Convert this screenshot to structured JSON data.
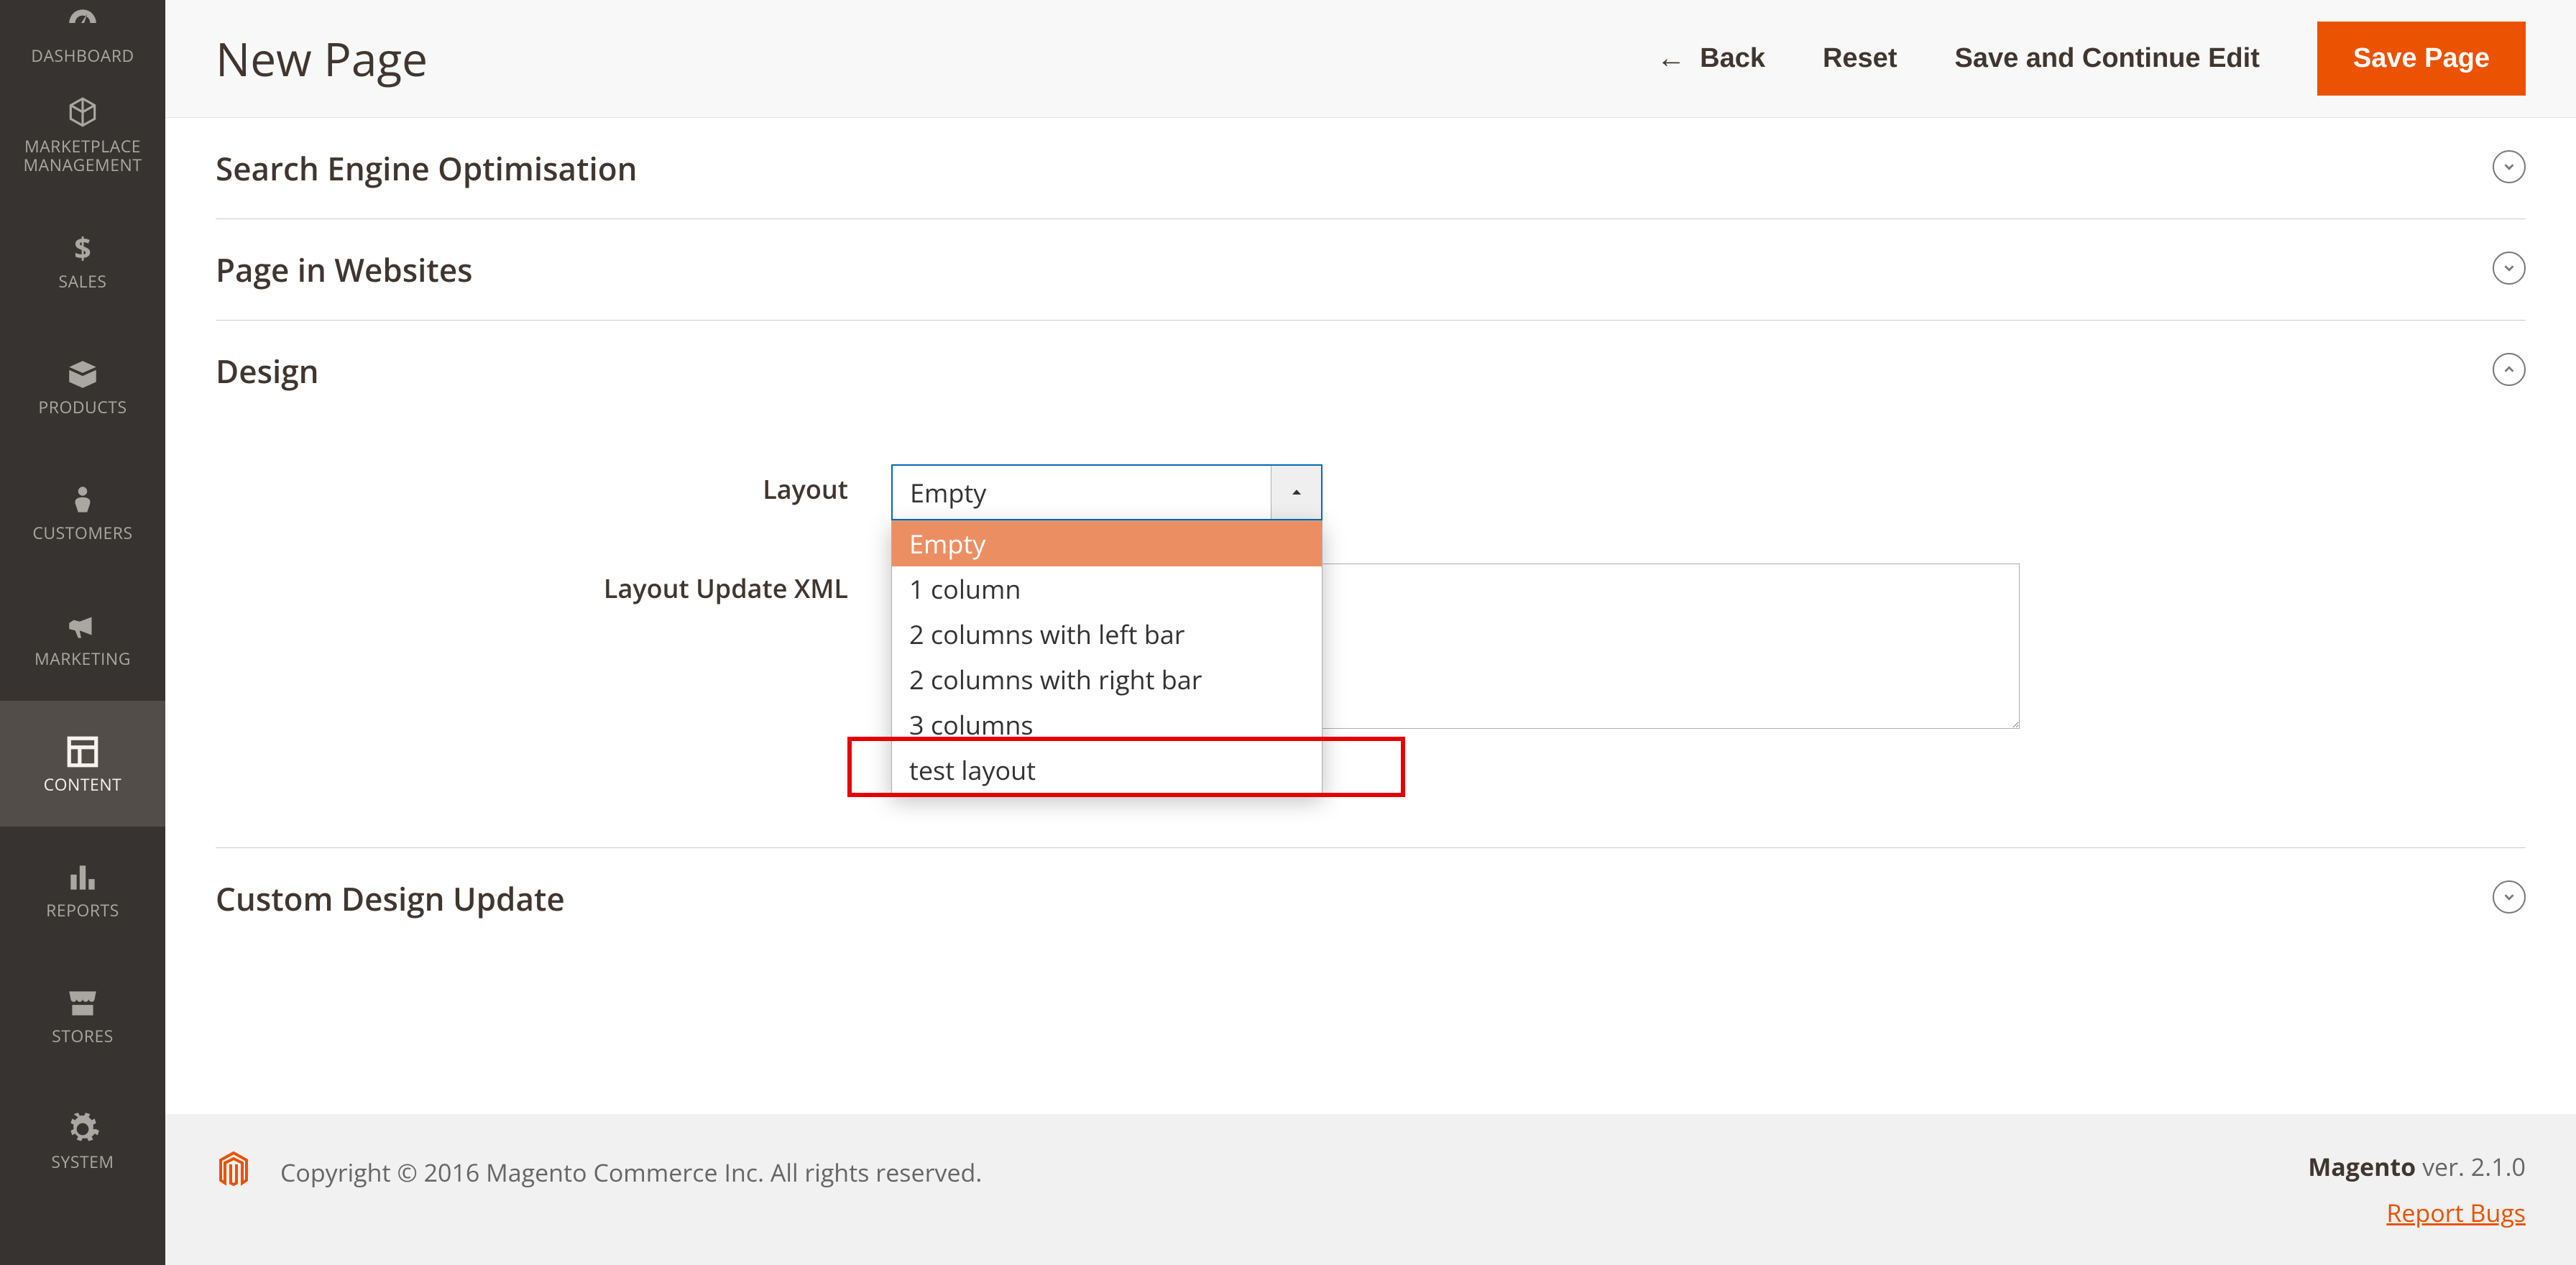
{
  "sidebar": {
    "items": [
      {
        "label": "DASHBOARD",
        "icon": "dashboard"
      },
      {
        "label": "MARKETPLACE MANAGEMENT",
        "icon": "marketplace"
      },
      {
        "label": "SALES",
        "icon": "sales"
      },
      {
        "label": "PRODUCTS",
        "icon": "products"
      },
      {
        "label": "CUSTOMERS",
        "icon": "customers"
      },
      {
        "label": "MARKETING",
        "icon": "marketing"
      },
      {
        "label": "CONTENT",
        "icon": "content"
      },
      {
        "label": "REPORTS",
        "icon": "reports"
      },
      {
        "label": "STORES",
        "icon": "stores"
      },
      {
        "label": "SYSTEM",
        "icon": "system"
      }
    ]
  },
  "header": {
    "title": "New Page",
    "back_label": "Back",
    "reset_label": "Reset",
    "savecont_label": "Save and Continue Edit",
    "save_label": "Save Page"
  },
  "sections": {
    "seo": {
      "title": "Search Engine Optimisation",
      "expanded": false
    },
    "websites": {
      "title": "Page in Websites",
      "expanded": false
    },
    "design": {
      "title": "Design",
      "expanded": true
    },
    "custom_design": {
      "title": "Custom Design Update",
      "expanded": false
    }
  },
  "design_form": {
    "layout_label": "Layout",
    "layout_selected": "Empty",
    "layout_options": [
      "Empty",
      "1 column",
      "2 columns with left bar",
      "2 columns with right bar",
      "3 columns",
      "test layout"
    ],
    "layout_update_label": "Layout Update XML",
    "layout_update_value": ""
  },
  "footer": {
    "copyright": "Copyright © 2016 Magento Commerce Inc. All rights reserved.",
    "brand": "Magento",
    "version_text": " ver. 2.1.0",
    "report_bugs": "Report Bugs"
  }
}
